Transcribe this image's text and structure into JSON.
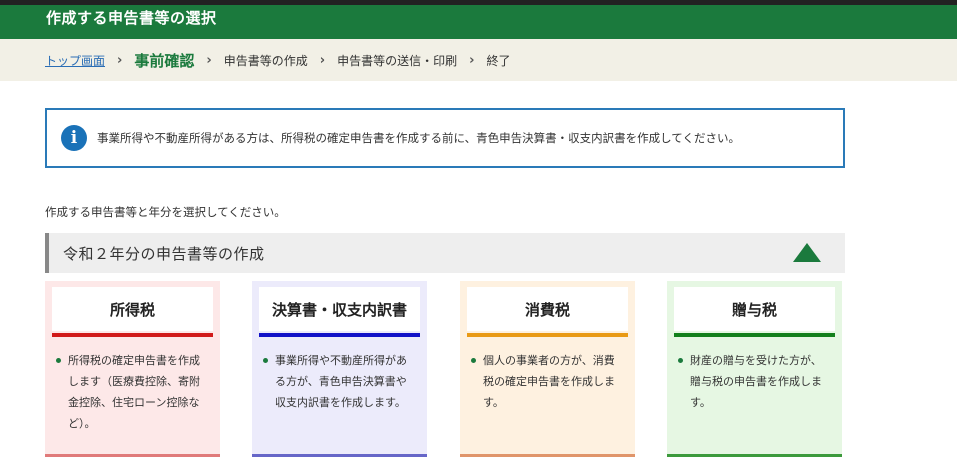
{
  "header": {
    "title": "作成する申告書等の選択"
  },
  "breadcrumb": {
    "items": [
      {
        "label": "トップ画面"
      },
      {
        "label": "事前確認"
      },
      {
        "label": "申告書等の作成"
      },
      {
        "label": "申告書等の送信・印刷"
      },
      {
        "label": "終了"
      }
    ],
    "separator": "›"
  },
  "info": {
    "icon": "i",
    "text": "事業所得や不動産所得がある方は、所得税の確定申告書を作成する前に、青色申告決算書・収支内訳書を作成してください。"
  },
  "instruction": "作成する申告書等と年分を選択してください。",
  "section": {
    "title": "令和２年分の申告書等の作成"
  },
  "cards": [
    {
      "title": "所得税",
      "description": "所得税の確定申告書を作成します（医療費控除、寄附金控除、住宅ローン控除など）。"
    },
    {
      "title": "決算書・収支内訳書",
      "description": "事業所得や不動産所得がある方が、青色申告決算書や収支内訳書を作成します。"
    },
    {
      "title": "消費税",
      "description": "個人の事業者の方が、消費税の確定申告書を作成します。"
    },
    {
      "title": "贈与税",
      "description": "財産の贈与を受けた方が、贈与税の申告書を作成します。"
    }
  ],
  "colors": {
    "header_green": "#1b7a3d",
    "shotokuzei_accent": "#d11a1a",
    "kessansho_accent": "#1212c8",
    "shohizei_accent": "#e99a15",
    "zoyozei_accent": "#13801c"
  }
}
